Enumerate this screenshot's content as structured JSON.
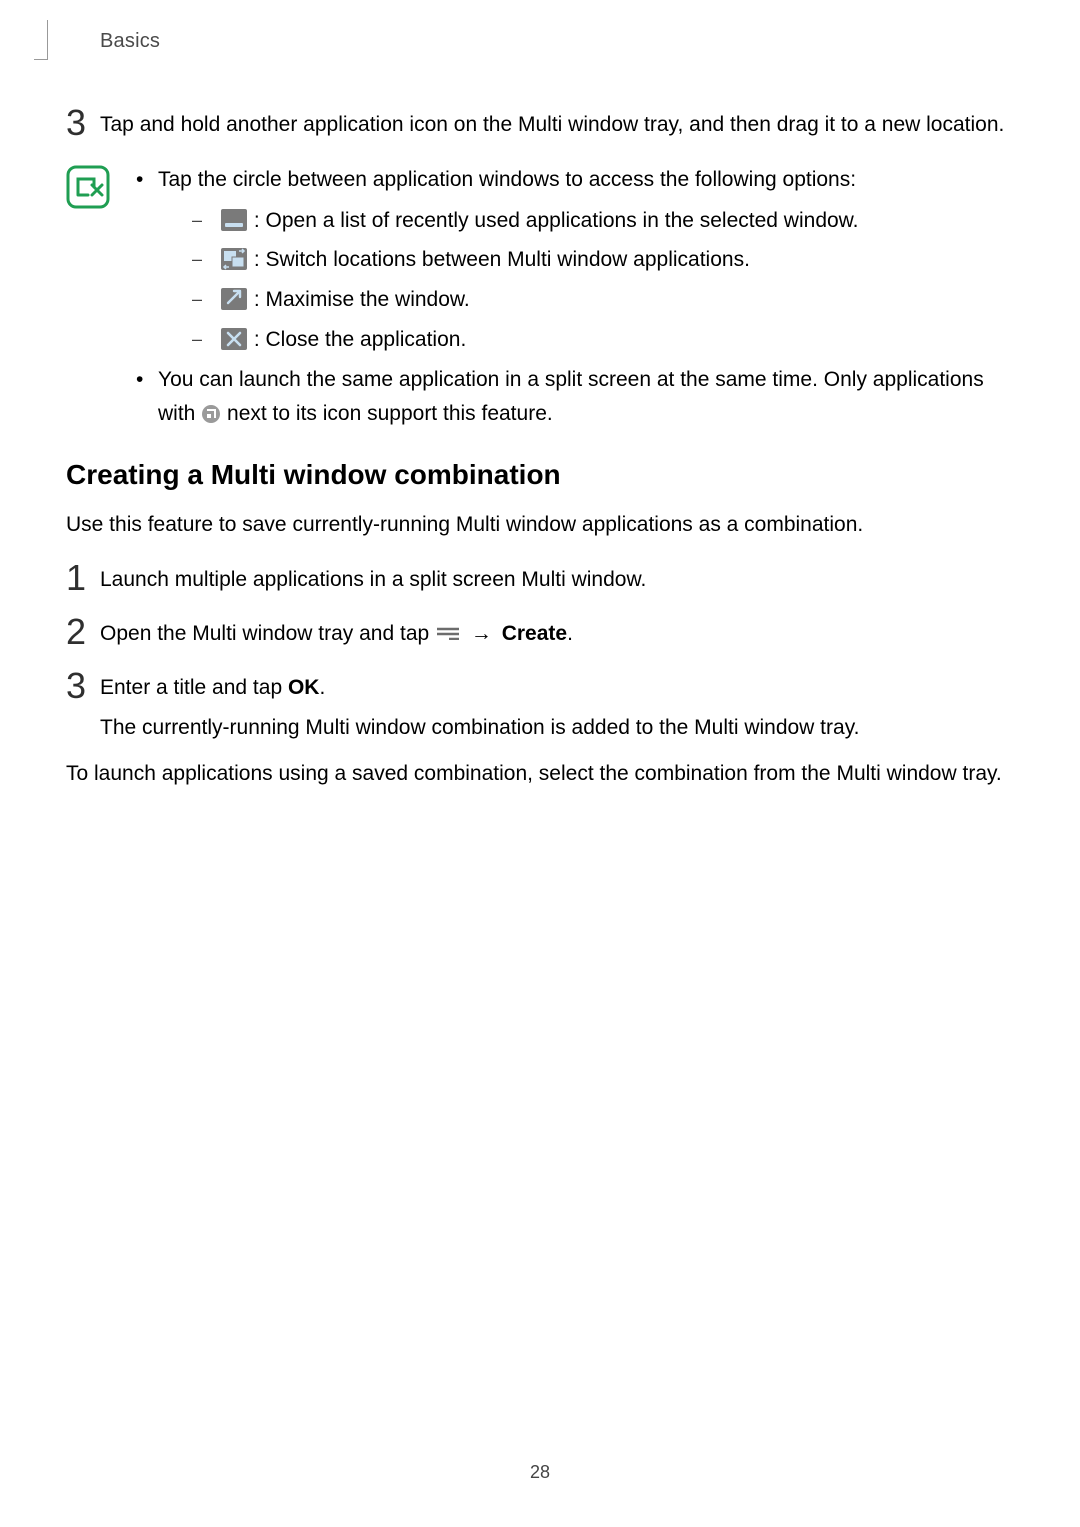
{
  "breadcrumb": "Basics",
  "step3": {
    "num": "3",
    "text": "Tap and hold another application icon on the Multi window tray, and then drag it to a new location."
  },
  "tip": {
    "item1": "Tap the circle between application windows to access the following options:",
    "sub1": " : Open a list of recently used applications in the selected window.",
    "sub2": " : Switch locations between Multi window applications.",
    "sub3": " : Maximise the window.",
    "sub4": " : Close the application.",
    "item2_a": "You can launch the same application in a split screen at the same time. Only applications with ",
    "item2_b": " next to its icon support this feature."
  },
  "section2": {
    "heading": "Creating a Multi window combination",
    "intro": "Use this feature to save currently-running Multi window applications as a combination.",
    "s1_num": "1",
    "s1_text": "Launch multiple applications in a split screen Multi window.",
    "s2_num": "2",
    "s2_text_a": "Open the Multi window tray and tap ",
    "s2_text_b": "Create",
    "s2_text_c": ".",
    "s3_num": "3",
    "s3_text_a": "Enter a title and tap ",
    "s3_text_b": "OK",
    "s3_text_c": ".",
    "s3_sub": "The currently-running Multi window combination is added to the Multi window tray.",
    "outro": "To launch applications using a saved combination, select the combination from the Multi window tray."
  },
  "page_number": "28"
}
